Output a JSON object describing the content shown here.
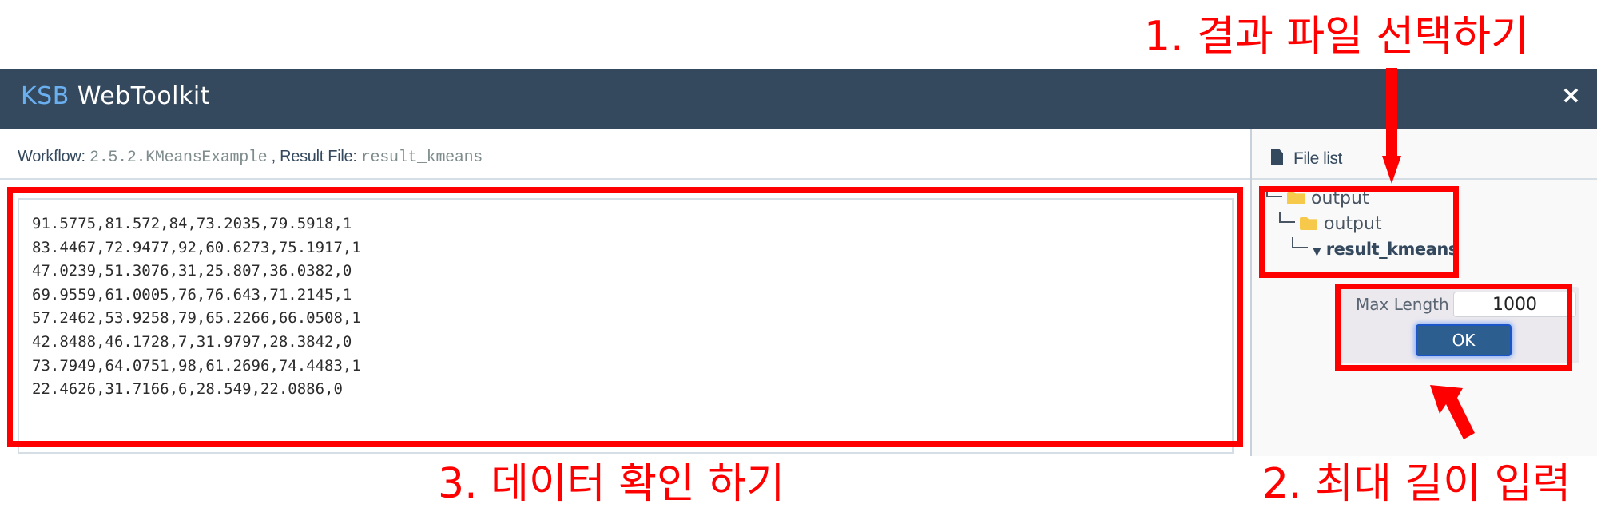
{
  "annotations": {
    "step1": "1. 결과 파일 선택하기",
    "step2": "2. 최대 길이 입력",
    "step3": "3. 데이터 확인 하기",
    "color": "#ff0000"
  },
  "header": {
    "brand_prefix": "KSB",
    "brand_name": "WebToolkit",
    "close_icon": "×",
    "background": "#34495e"
  },
  "infobar": {
    "workflow_label": "Workflow:",
    "workflow_value": "2.5.2.KMeansExample",
    "separator": ",",
    "result_label": "Result File:",
    "result_value": "result_kmeans"
  },
  "data_view": {
    "lines": [
      "91.5775,81.572,84,73.2035,79.5918,1",
      "83.4467,72.9477,92,60.6273,75.1917,1",
      "47.0239,51.3076,31,25.807,36.0382,0",
      "69.9559,61.0005,76,76.643,71.2145,1",
      "57.2462,53.9258,79,65.2266,66.0508,1",
      "42.8488,46.1728,7,31.9797,28.3842,0",
      "73.7949,64.0751,98,61.2696,74.4483,1",
      "22.4626,31.7166,6,28.549,22.0886,0"
    ]
  },
  "sidebar": {
    "title": "File list",
    "tree": [
      {
        "label": "output",
        "type": "folder",
        "level": 0
      },
      {
        "label": "output",
        "type": "folder",
        "level": 1
      },
      {
        "label": "result_kmeans",
        "type": "file",
        "level": 2,
        "selected": true
      }
    ],
    "max_length_label": "Max Length",
    "max_length_value": "1000",
    "ok_label": "OK"
  }
}
